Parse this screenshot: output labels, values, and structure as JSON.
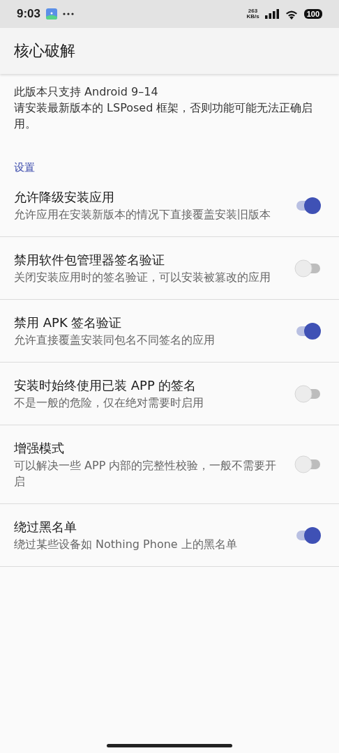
{
  "status_bar": {
    "time": "9:03",
    "net_speed": "263",
    "net_unit": "KB/s",
    "battery": "100"
  },
  "app_bar": {
    "title": "核心破解"
  },
  "notice": [
    "此版本只支持 Android 9–14",
    "请安装最新版本的 LSPosed 框架，否则功能可能无法正确启用。"
  ],
  "section": {
    "title": "设置"
  },
  "settings": [
    {
      "title": "允许降级安装应用",
      "summary": "允许应用在安装新版本的情况下直接覆盖安装旧版本",
      "on": true
    },
    {
      "title": "禁用软件包管理器签名验证",
      "summary": "关闭安装应用时的签名验证，可以安装被篡改的应用",
      "on": false
    },
    {
      "title": "禁用 APK 签名验证",
      "summary": "允许直接覆盖安装同包名不同签名的应用",
      "on": true
    },
    {
      "title": "安装时始终使用已装 APP 的签名",
      "summary": "不是一般的危险，仅在绝对需要时启用",
      "on": false
    },
    {
      "title": "增强模式",
      "summary": "可以解决一些 APP 内部的完整性校验，一般不需要开启",
      "on": false
    },
    {
      "title": "绕过黑名单",
      "summary": "绕过某些设备如 Nothing Phone 上的黑名单",
      "on": true
    }
  ]
}
